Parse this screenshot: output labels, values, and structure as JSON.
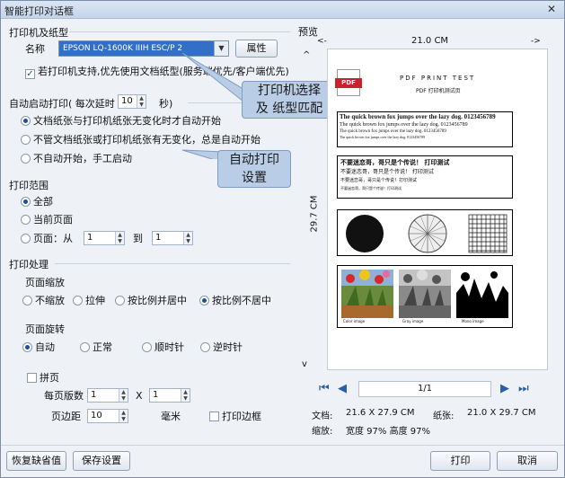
{
  "window": {
    "title": "智能打印对话框",
    "close_label": "✕"
  },
  "printer": {
    "group_title": "打印机及纸型",
    "name_label": "名称",
    "selected_printer": "EPSON LQ-1600K IIIH ESC/P 2",
    "properties_label": "属性",
    "use_doc_paper_label": "若打印机支持,优先使用文档纸型(服务端优先/客户端优先)",
    "use_doc_paper_checked": true
  },
  "auto_print": {
    "prefix_label": "自动启动打印( 每次延时",
    "delay_value": "10",
    "suffix_label": "秒)",
    "options": [
      "文档纸张与打印机纸张无变化时才自动开始",
      "不管文档纸张或打印机纸张有无变化，总是自动开始",
      "不自动开始，手工启动"
    ],
    "selected_index": 0
  },
  "callouts": {
    "printer_callout_line1": "打印机选择",
    "printer_callout_line2": "及 纸型匹配",
    "auto_callout_line1": "自动打印",
    "auto_callout_line2": "设置"
  },
  "range": {
    "group_title": "打印范围",
    "all_label": "全部",
    "current_label": "当前页面",
    "pages_label": "页面：从",
    "from_value": "1",
    "to_label": "到",
    "to_value": "1",
    "selected": "all"
  },
  "processing": {
    "group_title": "打印处理",
    "scale_title": "页面缩放",
    "scale_options": [
      "不缩放",
      "拉伸",
      "按比例并居中",
      "按比例不居中"
    ],
    "scale_selected_index": 3,
    "rotate_title": "页面旋转",
    "rotate_options": [
      "自动",
      "正常",
      "顺时针",
      "逆时针"
    ],
    "rotate_selected_index": 0,
    "tile_label": "拼页",
    "tile_checked": false,
    "per_page_label": "每页版数",
    "per_page_x": "1",
    "times_label": "X",
    "per_page_y": "1",
    "margin_label": "页边距",
    "margin_value": "10",
    "margin_unit": "毫米",
    "print_border_label": "打印边框",
    "print_border_checked": false
  },
  "preview": {
    "title": "预览",
    "width_label": "21.0 CM",
    "height_label": "29.7 CM",
    "left_arrow": "<-",
    "right_arrow": "->",
    "up_arrow": "^",
    "down_arrow": "v",
    "pdf_badge": "PDF",
    "header_line1": "PDF PRINT TEST",
    "header_line2": "PDF 打印机测试页",
    "fox_lines": [
      "The quick brown fox jumps over the lazy dog. 0123456789",
      "The quick brown fox jumps over the lazy dog. 0123456789",
      "The quick brown fox jumps over the lazy dog. 0123456789",
      "The quick brown fox jumps over the lazy dog. 0123456789"
    ],
    "cn_lines": [
      "不要迷恋哥，哥只是个传说！    打印测试",
      "不要迷恋哥，哥只是个传说！  打印测试",
      "不要迷恋哥，哥只是个传说！打印测试",
      "不要迷恋哥，哥只是个传说！打印测试"
    ],
    "image_captions": [
      "Color image",
      "Gray image",
      "Mono image"
    ],
    "page_indicator": "1/1"
  },
  "info": {
    "doc_label": "文档:",
    "doc_value": "21.6 X 27.9 CM",
    "paper_label": "纸张:",
    "paper_value": "21.0 X 29.7 CM",
    "scale_label": "缩放:",
    "scale_value": "宽度 97%  高度 97%"
  },
  "buttons": {
    "restore_defaults": "恢复缺省值",
    "save_settings": "保存设置",
    "print": "打印",
    "cancel": "取消"
  },
  "colors": {
    "accent": "#3170c6",
    "callout_bg": "#b9cde7",
    "nav_icon": "#2a5ea8"
  }
}
